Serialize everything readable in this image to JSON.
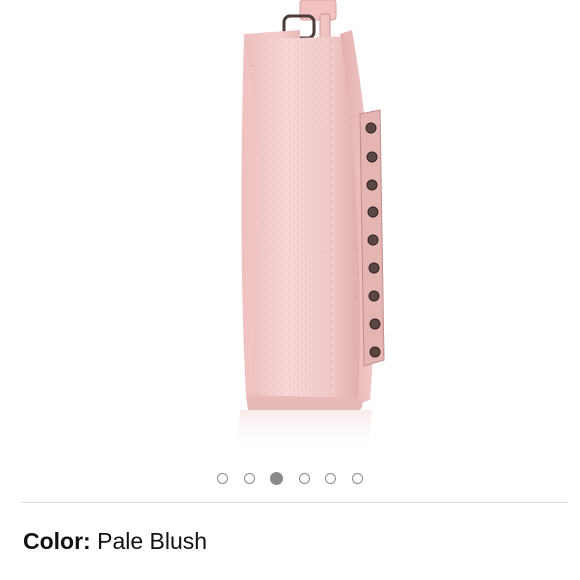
{
  "gallery": {
    "image_alt": "pale blush leather crossbody bag, side view with grommet studs",
    "dot_count": 6,
    "active_dot": 3
  },
  "color": {
    "label": "Color:",
    "value": "Pale Blush"
  },
  "colors": {
    "bag_pink": "#f1c6c6",
    "bag_pink_light": "#f6d3d2",
    "bag_pink_shadow": "#dba9a8",
    "hardware": "#4a3b38",
    "dot_gray": "#8a8a8a",
    "divider": "#d9d9d9"
  }
}
